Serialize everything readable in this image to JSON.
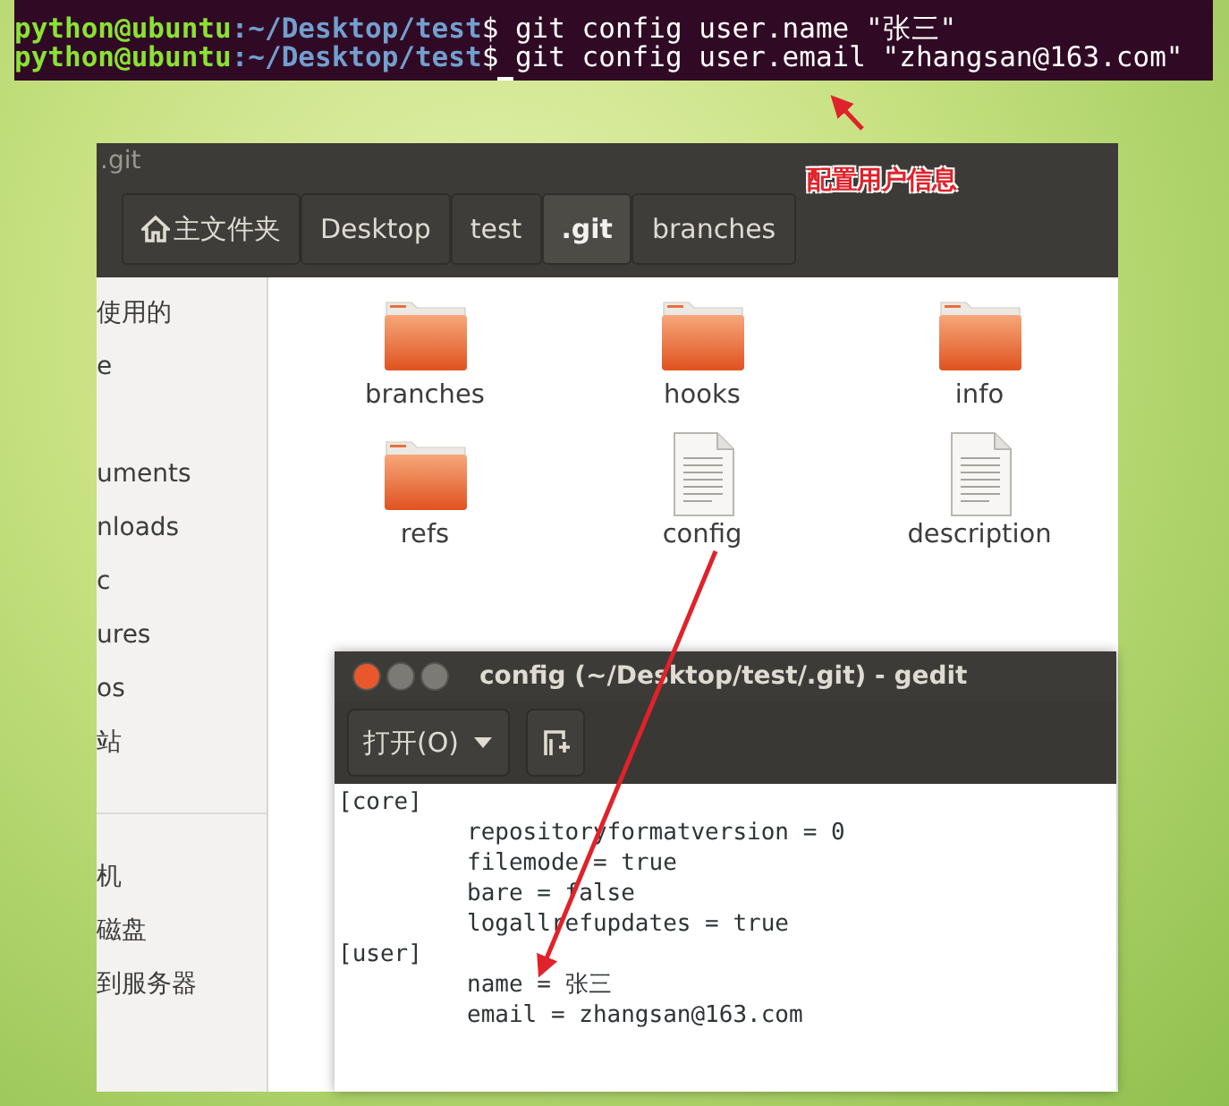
{
  "terminal": {
    "lines": [
      {
        "user": "python@ubuntu",
        "path": ":~/Desktop/test",
        "command": "$ git config user.name \"张三\""
      },
      {
        "user": "python@ubuntu",
        "path": ":~/Desktop/test",
        "command": "$ git config user.email \"zhangsan@163.com\""
      }
    ]
  },
  "annotation": {
    "text": "配置用户信息"
  },
  "file_manager": {
    "title": ".git",
    "path_bar": [
      {
        "label": "主文件夹",
        "kind": "home",
        "selected": false
      },
      {
        "label": "Desktop",
        "kind": "folder",
        "selected": false
      },
      {
        "label": "test",
        "kind": "folder",
        "selected": false
      },
      {
        "label": ".git",
        "kind": "folder",
        "selected": true
      },
      {
        "label": "branches",
        "kind": "folder",
        "selected": false
      }
    ],
    "sidebar": {
      "groups": [
        [
          {
            "label": "使用的"
          },
          {
            "label": "e"
          }
        ],
        [
          {
            "label": "uments"
          },
          {
            "label": "nloads"
          },
          {
            "label": "c"
          },
          {
            "label": "ures"
          },
          {
            "label": "os"
          },
          {
            "label": "站"
          }
        ],
        [
          {
            "label": "机"
          },
          {
            "label": "磁盘"
          },
          {
            "label": "到服务器"
          }
        ]
      ]
    },
    "files": [
      {
        "name": "branches",
        "kind": "folder"
      },
      {
        "name": "hooks",
        "kind": "folder"
      },
      {
        "name": "info",
        "kind": "folder"
      },
      {
        "name": "refs",
        "kind": "folder"
      },
      {
        "name": "config",
        "kind": "file"
      },
      {
        "name": "description",
        "kind": "file"
      }
    ]
  },
  "gedit": {
    "title": "config (~/Desktop/test/.git) - gedit",
    "open_button": "打开(O)",
    "lines": [
      {
        "kind": "section",
        "text": "[core]"
      },
      {
        "kind": "entry",
        "text": "repositoryformatversion = 0"
      },
      {
        "kind": "entry",
        "text": "filemode = true"
      },
      {
        "kind": "entry",
        "text": "bare = false"
      },
      {
        "kind": "entry",
        "text": "logallrefupdates = true"
      },
      {
        "kind": "section",
        "text": "[user]"
      },
      {
        "kind": "entry",
        "text": "name = 张三"
      },
      {
        "kind": "entry",
        "text": "email = zhangsan@163.com"
      }
    ]
  }
}
